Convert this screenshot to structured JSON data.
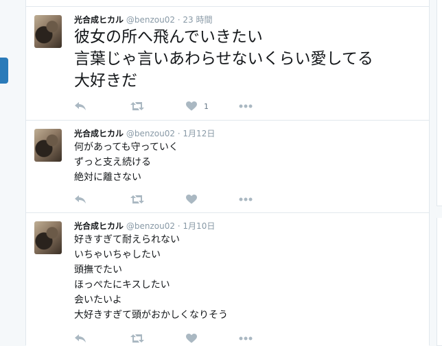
{
  "tweets": [
    {
      "name": "光合成ヒカル",
      "handle": "@benzou02",
      "sep": " · ",
      "time": "23 時間",
      "lines": [
        "彼女の所へ飛んでいきたい",
        "言葉じゃ言いあわらせないくらい愛してる",
        "大好きだ"
      ],
      "like_count": "1"
    },
    {
      "name": "光合成ヒカル",
      "handle": "@benzou02",
      "sep": " · ",
      "time": "1月12日",
      "lines": [
        "何があっても守っていく",
        "ずっと支え続ける",
        "絶対に離さない"
      ],
      "like_count": ""
    },
    {
      "name": "光合成ヒカル",
      "handle": "@benzou02",
      "sep": " · ",
      "time": "1月10日",
      "lines": [
        "好きすぎて耐えられない",
        "いちゃいちゃしたい",
        "頭撫でたい",
        "ほっぺたにキスしたい",
        "会いたいよ",
        "大好きすぎて頭がおかしくなりそう"
      ],
      "like_count": ""
    }
  ],
  "icons": {
    "reply": "reply-icon",
    "retweet": "retweet-icon",
    "like": "heart-icon",
    "more": "more-icon"
  },
  "colors": {
    "action": "#aab8c2",
    "meta": "#8899a6",
    "accent": "#2b7bb9"
  }
}
